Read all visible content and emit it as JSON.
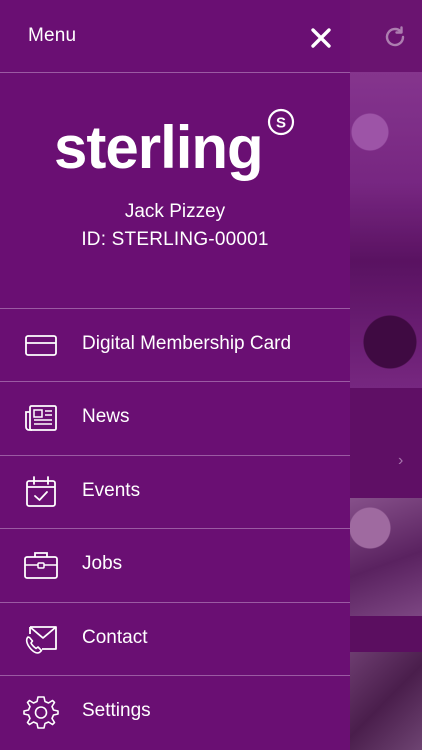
{
  "header": {
    "title": "Menu",
    "close_icon": "close-icon"
  },
  "background": {
    "refresh_icon": "refresh-icon",
    "chevron_icon": "chevron-right-icon"
  },
  "profile": {
    "logo_text": "sterling",
    "logo_mark": "S",
    "name": "Jack Pizzey",
    "id_text": "ID: STERLING-00001"
  },
  "menu": [
    {
      "label": "Digital Membership Card",
      "icon": "card-icon"
    },
    {
      "label": "News",
      "icon": "newspaper-icon"
    },
    {
      "label": "Events",
      "icon": "calendar-check-icon"
    },
    {
      "label": "Jobs",
      "icon": "briefcase-icon"
    },
    {
      "label": "Contact",
      "icon": "envelope-phone-icon"
    },
    {
      "label": "Settings",
      "icon": "gear-icon"
    }
  ],
  "colors": {
    "drawer": "#6a0f73",
    "background": "#5e0f62",
    "divider": "#9b5aa3",
    "text": "#ffffff"
  }
}
